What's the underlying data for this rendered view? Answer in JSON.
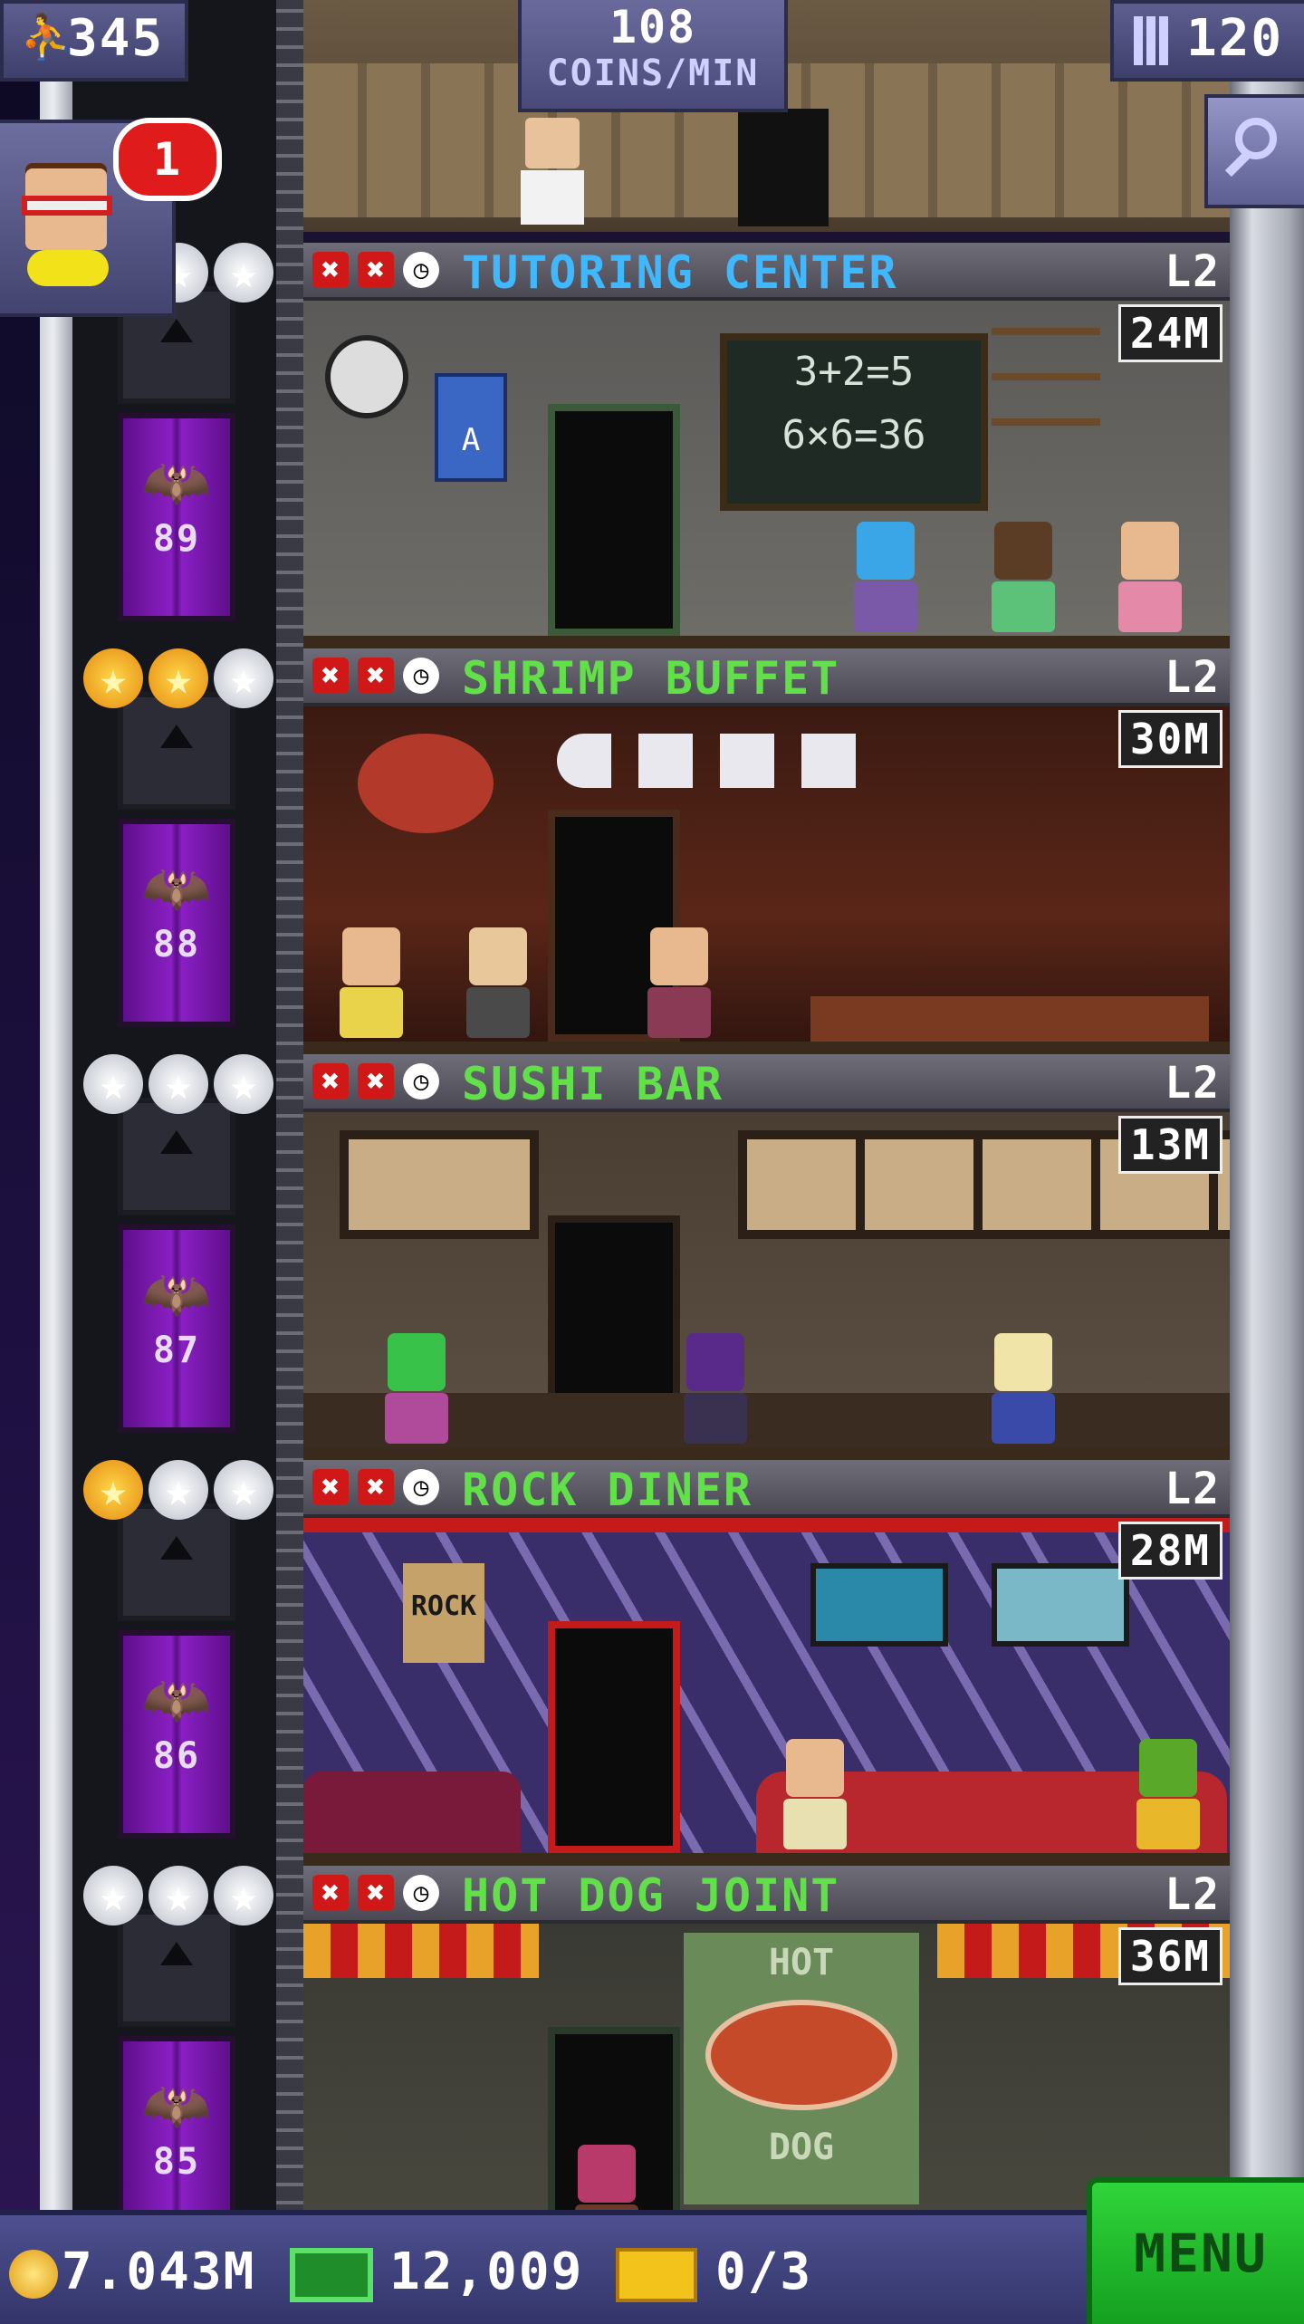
{
  "hud": {
    "population": "345",
    "coins_per_min_value": "108",
    "coins_per_min_unit": "COINS/MIN",
    "floors": "120",
    "vip_badge": "1"
  },
  "floors": [
    {
      "name": "TUTORING CENTER",
      "level": "L2",
      "timer": "24M",
      "number": "89",
      "name_color": "#3fb8ff",
      "stars": [
        "silver",
        "silver",
        "silver"
      ]
    },
    {
      "name": "SHRIMP BUFFET",
      "level": "L2",
      "timer": "30M",
      "number": "88",
      "name_color": "#62e04a",
      "stars": [
        "gold",
        "gold",
        "silver"
      ]
    },
    {
      "name": "SUSHI BAR",
      "level": "L2",
      "timer": "13M",
      "number": "87",
      "name_color": "#62e04a",
      "stars": [
        "silver",
        "silver",
        "silver"
      ]
    },
    {
      "name": "ROCK DINER",
      "level": "L2",
      "timer": "28M",
      "number": "86",
      "name_color": "#62e04a",
      "stars": [
        "gold",
        "silver",
        "silver"
      ]
    },
    {
      "name": "HOT DOG JOINT",
      "level": "L2",
      "timer": "36M",
      "number": "85",
      "name_color": "#62e04a",
      "stars": [
        "silver",
        "silver",
        "silver"
      ]
    }
  ],
  "room_text": {
    "chalk_line1": "3+2=5",
    "chalk_line2": "6×6=36",
    "poster_letter": "A",
    "hotdog_top": "HOT",
    "hotdog_bottom": "DOG",
    "rock_poster": "ROCK"
  },
  "bottom_bar": {
    "coins": "7.043M",
    "bux": "12,009",
    "tickets": "0/3",
    "menu_label": "MENU"
  },
  "colors": {
    "elevator_door": "#8a1fc4",
    "menu_green": "#2fd53a",
    "hud_blue": "#4e5090",
    "x_red": "#d01818"
  }
}
